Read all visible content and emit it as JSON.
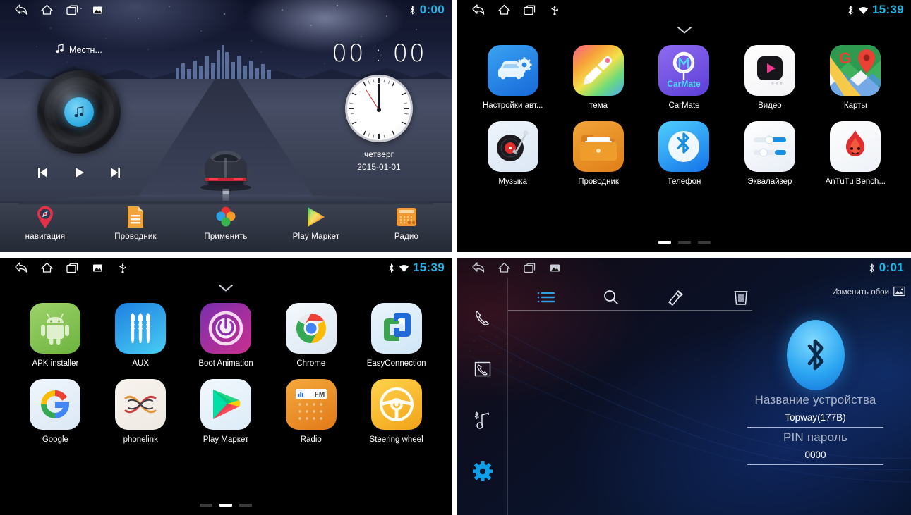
{
  "panels": {
    "home": {
      "statusbar": {
        "nav_icons": [
          "back-icon",
          "home-icon",
          "recents-icon",
          "screenshot-icon"
        ],
        "indicators": [
          "bluetooth-icon"
        ],
        "clock": "0:00"
      },
      "track_label": "Местн...",
      "digital_time": "00 : 00",
      "weekday": "четверг",
      "date": "2015-01-01",
      "media_controls": [
        "previous-icon",
        "play-icon",
        "next-icon"
      ],
      "dock": [
        {
          "label": "навигация",
          "icon": "navigation-pin-icon"
        },
        {
          "label": "Проводник",
          "icon": "file-manager-icon"
        },
        {
          "label": "Применить",
          "icon": "apply-flower-icon"
        },
        {
          "label": "Play Маркет",
          "icon": "play-store-icon"
        },
        {
          "label": "Радио",
          "icon": "radio-icon"
        }
      ]
    },
    "apps_page1": {
      "statusbar": {
        "nav_icons": [
          "back-icon",
          "home-icon",
          "recents-icon",
          "usb-icon"
        ],
        "indicators": [
          "bluetooth-icon",
          "wifi-icon"
        ],
        "clock": "15:39"
      },
      "apps": [
        {
          "label": "Настройки авт...",
          "icon": "car-settings-icon"
        },
        {
          "label": "тема",
          "icon": "theme-brush-icon"
        },
        {
          "label": "CarMate",
          "icon": "carmate-icon"
        },
        {
          "label": "Видео",
          "icon": "video-player-icon"
        },
        {
          "label": "Карты",
          "icon": "google-maps-icon"
        },
        {
          "label": "Музыка",
          "icon": "music-turntable-icon"
        },
        {
          "label": "Проводник",
          "icon": "file-manager-icon"
        },
        {
          "label": "Телефон",
          "icon": "bluetooth-phone-icon"
        },
        {
          "label": "Эквалайзер",
          "icon": "equalizer-icon"
        },
        {
          "label": "AnTuTu Bench...",
          "icon": "antutu-icon"
        }
      ],
      "page_dots": {
        "count": 3,
        "active": 0
      }
    },
    "apps_page2": {
      "statusbar": {
        "nav_icons": [
          "back-icon",
          "home-icon",
          "recents-icon",
          "screenshot-icon",
          "usb-icon"
        ],
        "indicators": [
          "bluetooth-icon",
          "wifi-icon"
        ],
        "clock": "15:39"
      },
      "apps": [
        {
          "label": "APK installer",
          "icon": "android-robot-icon"
        },
        {
          "label": "AUX",
          "icon": "aux-jack-icon"
        },
        {
          "label": "Boot Animation",
          "icon": "power-icon"
        },
        {
          "label": "Chrome",
          "icon": "chrome-icon"
        },
        {
          "label": "EasyConnection",
          "icon": "easyconnection-icon"
        },
        {
          "label": "Google",
          "icon": "google-g-icon"
        },
        {
          "label": "phonelink",
          "icon": "phonelink-icon"
        },
        {
          "label": "Play Маркет",
          "icon": "play-store-icon"
        },
        {
          "label": "Radio",
          "icon": "radio-fm-icon"
        },
        {
          "label": "Steering wheel",
          "icon": "steering-wheel-icon"
        }
      ],
      "page_dots": {
        "count": 3,
        "active": 1
      }
    },
    "bluetooth": {
      "statusbar": {
        "nav_icons": [
          "back-icon",
          "home-icon",
          "recents-icon",
          "screenshot-icon"
        ],
        "indicators": [
          "bluetooth-icon"
        ],
        "clock": "0:01"
      },
      "sidebar": [
        {
          "icon": "dialpad-phone-icon",
          "active": false
        },
        {
          "icon": "call-history-icon",
          "active": false
        },
        {
          "icon": "bluetooth-music-icon",
          "active": false
        },
        {
          "icon": "settings-gear-icon",
          "active": true
        }
      ],
      "toolbar": [
        {
          "icon": "list-icon",
          "active": true
        },
        {
          "icon": "search-icon",
          "active": false
        },
        {
          "icon": "edit-icon",
          "active": false
        },
        {
          "icon": "trash-icon",
          "active": false
        }
      ],
      "wallpaper_button": {
        "label": "Изменить обои",
        "icon": "wallpaper-icon"
      },
      "device_name_label": "Название устройства",
      "device_name_value": "Topway(177B)",
      "pin_label": "PIN пароль",
      "pin_value": "0000"
    }
  },
  "colors": {
    "accent_cyan": "#1fb6e8",
    "bluetooth_blue": "#2ea7f2",
    "app_screen_bg": "#000000"
  }
}
